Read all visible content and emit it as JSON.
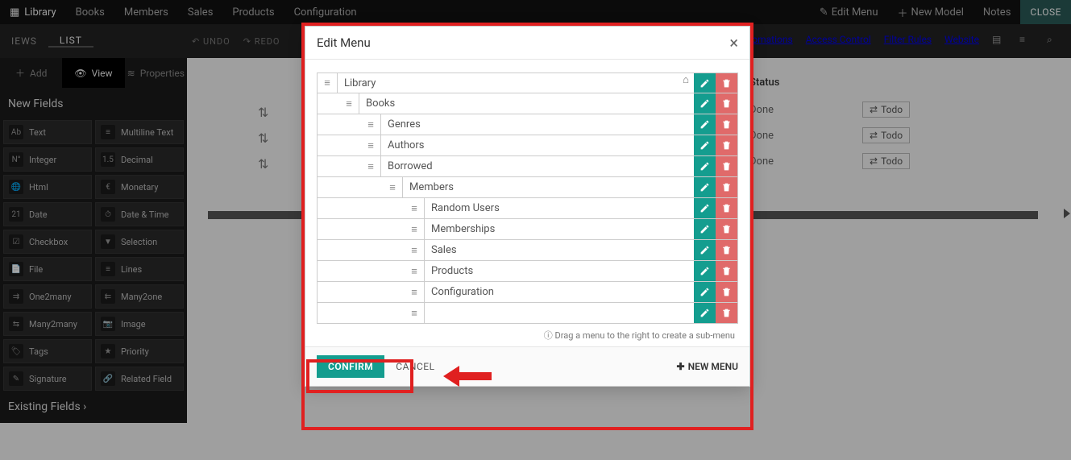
{
  "topnav": {
    "brand": "Library",
    "items": [
      "Books",
      "Members",
      "Sales",
      "Products",
      "Configuration"
    ],
    "right": {
      "edit_menu": "Edit Menu",
      "new_model": "New Model",
      "notes": "Notes",
      "close": "CLOSE"
    }
  },
  "bar2": {
    "left": [
      "IEWS",
      "LIST"
    ],
    "undo": "UNDO",
    "redo": "REDO",
    "right": [
      "Automations",
      "Access Control",
      "Filter Rules",
      "Website"
    ]
  },
  "panel": {
    "tabs": {
      "add": "Add",
      "view": "View",
      "properties": "Properties"
    },
    "new_fields": "New Fields",
    "existing_fields": "Existing Fields",
    "fields": [
      {
        "icon": "Ab",
        "label": "Text"
      },
      {
        "icon": "≡",
        "label": "Multiline Text"
      },
      {
        "icon": "N°",
        "label": "Integer"
      },
      {
        "icon": "1.5",
        "label": "Decimal"
      },
      {
        "icon": "🌐",
        "label": "Html"
      },
      {
        "icon": "€",
        "label": "Monetary"
      },
      {
        "icon": "21",
        "label": "Date"
      },
      {
        "icon": "⏱",
        "label": "Date & Time"
      },
      {
        "icon": "☑",
        "label": "Checkbox"
      },
      {
        "icon": "▼",
        "label": "Selection"
      },
      {
        "icon": "📄",
        "label": "File"
      },
      {
        "icon": "≡",
        "label": "Lines"
      },
      {
        "icon": "⇉",
        "label": "One2many"
      },
      {
        "icon": "⇇",
        "label": "Many2one"
      },
      {
        "icon": "⇆",
        "label": "Many2many"
      },
      {
        "icon": "📷",
        "label": "Image"
      },
      {
        "icon": "🏷",
        "label": "Tags"
      },
      {
        "icon": "★",
        "label": "Priority"
      },
      {
        "icon": "✎",
        "label": "Signature"
      },
      {
        "icon": "🔗",
        "label": "Related Field"
      }
    ]
  },
  "modal": {
    "title": "Edit Menu",
    "rows": [
      {
        "indent": 0,
        "label": "Library",
        "home": true
      },
      {
        "indent": 1,
        "label": "Books"
      },
      {
        "indent": 2,
        "label": "Genres"
      },
      {
        "indent": 2,
        "label": "Authors"
      },
      {
        "indent": 2,
        "label": "Borrowed"
      },
      {
        "indent": 3,
        "label": "Members"
      },
      {
        "indent": 4,
        "label": "Random Users"
      },
      {
        "indent": 4,
        "label": "Memberships"
      },
      {
        "indent": 4,
        "label": "Sales"
      },
      {
        "indent": 4,
        "label": "Products"
      },
      {
        "indent": 4,
        "label": "Configuration"
      },
      {
        "indent": 4,
        "label": ""
      }
    ],
    "hint": "Drag a menu to the right to create a sub-menu",
    "confirm": "CONFIRM",
    "cancel": "CANCEL",
    "new": "NEW MENU"
  },
  "right_table": {
    "status": "Status",
    "rows": [
      {
        "done": "Done",
        "todo": "Todo"
      },
      {
        "done": "Done",
        "todo": "Todo"
      },
      {
        "done": "Done",
        "todo": "Todo"
      }
    ]
  }
}
